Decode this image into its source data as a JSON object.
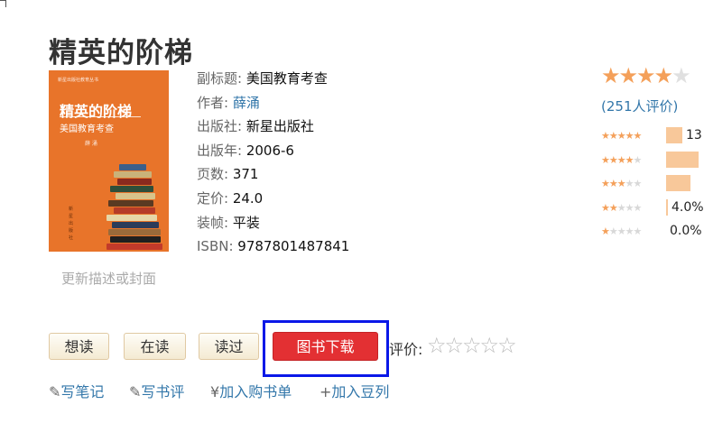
{
  "book": {
    "title": "精英的阶梯",
    "cover": {
      "series": "新星出版社教育丛书",
      "title": "精英的阶梯",
      "subtitle": "美国教育考查",
      "author": "薛 涌",
      "vertical_text": "新星出版社",
      "color": "#e8742a"
    },
    "update_link": "更新描述或封面",
    "meta": [
      {
        "label": "副标题:",
        "value": " 美国教育考查",
        "link": false
      },
      {
        "label": "作者:",
        "value": " 薛涌",
        "link": true
      },
      {
        "label": "出版社:",
        "value": " 新星出版社",
        "link": false
      },
      {
        "label": "出版年:",
        "value": " 2006-6",
        "link": false
      },
      {
        "label": "页数:",
        "value": " 371",
        "link": false
      },
      {
        "label": "定价:",
        "value": " 24.0",
        "link": false
      },
      {
        "label": "装帧:",
        "value": " 平装",
        "link": false
      },
      {
        "label": "ISBN:",
        "value": " 9787801487841",
        "link": false
      }
    ]
  },
  "rating": {
    "stars": 4,
    "count_text": "(251人评价)",
    "distribution": [
      {
        "stars": 5,
        "percent_text": "13",
        "bar_fraction": 0.3
      },
      {
        "stars": 4,
        "percent_text": "",
        "bar_fraction": 0.6
      },
      {
        "stars": 3,
        "percent_text": "",
        "bar_fraction": 0.45
      },
      {
        "stars": 2,
        "percent_text": "4.0%",
        "bar_fraction": 0.04
      },
      {
        "stars": 1,
        "percent_text": "0.0%",
        "bar_fraction": 0.0
      }
    ],
    "accent_color": "#f4a05a"
  },
  "actions": {
    "want_read": "想读",
    "reading": "在读",
    "read": "读过",
    "download": "图书下载",
    "my_rating_label": "评价:",
    "download_color": "#e33033",
    "highlight_color": "#0a18e8"
  },
  "links": {
    "write_note": "写笔记",
    "write_review": "写书评",
    "add_cart": "加入购书单",
    "add_doulist": "加入豆列",
    "pencil_icon": "✎",
    "yen_icon": "¥",
    "plus_icon": "+"
  }
}
